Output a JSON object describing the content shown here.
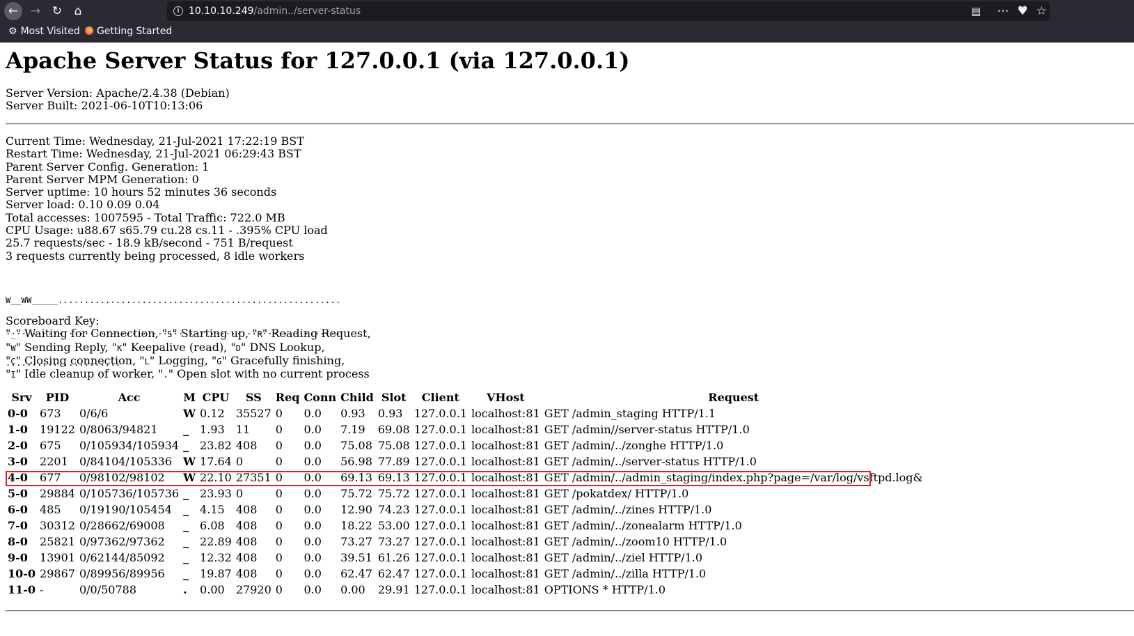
{
  "browser": {
    "url_host": "10.10.10.249",
    "url_path": "/admin../server-status",
    "bookmarks": [
      {
        "label": "Most Visited",
        "icon": "gear-icon"
      },
      {
        "label": "Getting Started",
        "icon": "firefox-icon"
      }
    ]
  },
  "page": {
    "title": "Apache Server Status for 127.0.0.1 (via 127.0.0.1)",
    "server_version": "Server Version: Apache/2.4.38 (Debian)",
    "server_built": "Server Built: 2021-06-10T10:13:06",
    "info_lines": [
      "Current Time: Wednesday, 21-Jul-2021 17:22:19 BST",
      "Restart Time: Wednesday, 21-Jul-2021 06:29:43 BST",
      "Parent Server Config. Generation: 1",
      "Parent Server MPM Generation: 0",
      "Server uptime: 10 hours 52 minutes 36 seconds",
      "Server load: 0.10 0.09 0.04",
      "Total accesses: 1007595 - Total Traffic: 722.0 MB",
      "CPU Usage: u88.67 s65.79 cu.28 cs.11 - .395% CPU load",
      "25.7 requests/sec - 18.9 kB/second - 751 B/request",
      "3 requests currently being processed, 8 idle workers"
    ],
    "scoreboard": [
      "W__WW_____......................................................",
      "................................................................",
      "......................"
    ],
    "key_title": "Scoreboard Key:",
    "key_lines": [
      [
        "\"",
        "_",
        "\" Waiting for Connection, \"",
        "S",
        "\" Starting up, \"",
        "R",
        "\" Reading Request,"
      ],
      [
        "\"",
        "W",
        "\" Sending Reply, \"",
        "K",
        "\" Keepalive (read), \"",
        "D",
        "\" DNS Lookup,"
      ],
      [
        "\"",
        "C",
        "\" Closing connection, \"",
        "L",
        "\" Logging, \"",
        "G",
        "\" Gracefully finishing,"
      ],
      [
        "\"",
        "I",
        "\" Idle cleanup of worker, \"",
        ".",
        "\" Open slot with no current process"
      ]
    ],
    "table_headers": [
      "Srv",
      "PID",
      "Acc",
      "M",
      "CPU",
      "SS",
      "Req",
      "Conn",
      "Child",
      "Slot",
      "Client",
      "VHost",
      "Request"
    ],
    "rows": [
      [
        "0-0",
        "673",
        "0/6/6",
        "W",
        "0.12",
        "35527",
        "0",
        "0.0",
        "0.93",
        "0.93",
        "127.0.0.1",
        "localhost:81",
        "GET /admin_staging HTTP/1.1"
      ],
      [
        "1-0",
        "19122",
        "0/8063/94821",
        "_",
        "1.93",
        "11",
        "0",
        "0.0",
        "7.19",
        "69.08",
        "127.0.0.1",
        "localhost:81",
        "GET /admin//server-status HTTP/1.0"
      ],
      [
        "2-0",
        "675",
        "0/105934/105934",
        "_",
        "23.82",
        "408",
        "0",
        "0.0",
        "75.08",
        "75.08",
        "127.0.0.1",
        "localhost:81",
        "GET /admin/../zonghe HTTP/1.0"
      ],
      [
        "3-0",
        "2201",
        "0/84104/105336",
        "W",
        "17.64",
        "0",
        "0",
        "0.0",
        "56.98",
        "77.89",
        "127.0.0.1",
        "localhost:81",
        "GET /admin/../server-status HTTP/1.0"
      ],
      [
        "4-0",
        "677",
        "0/98102/98102",
        "W",
        "22.10",
        "27351",
        "0",
        "0.0",
        "69.13",
        "69.13",
        "127.0.0.1",
        "localhost:81",
        "GET /admin/../admin_staging/index.php?page=/var/log/vsftpd.log&"
      ],
      [
        "5-0",
        "29884",
        "0/105736/105736",
        "_",
        "23.93",
        "0",
        "0",
        "0.0",
        "75.72",
        "75.72",
        "127.0.0.1",
        "localhost:81",
        "GET /pokatdex/ HTTP/1.0"
      ],
      [
        "6-0",
        "485",
        "0/19190/105454",
        "_",
        "4.15",
        "408",
        "0",
        "0.0",
        "12.90",
        "74.23",
        "127.0.0.1",
        "localhost:81",
        "GET /admin/../zines HTTP/1.0"
      ],
      [
        "7-0",
        "30312",
        "0/28662/69008",
        "_",
        "6.08",
        "408",
        "0",
        "0.0",
        "18.22",
        "53.00",
        "127.0.0.1",
        "localhost:81",
        "GET /admin/../zonealarm HTTP/1.0"
      ],
      [
        "8-0",
        "25821",
        "0/97362/97362",
        "_",
        "22.89",
        "408",
        "0",
        "0.0",
        "73.27",
        "73.27",
        "127.0.0.1",
        "localhost:81",
        "GET /admin/../zoom10 HTTP/1.0"
      ],
      [
        "9-0",
        "13901",
        "0/62144/85092",
        "_",
        "12.32",
        "408",
        "0",
        "0.0",
        "39.51",
        "61.26",
        "127.0.0.1",
        "localhost:81",
        "GET /admin/../ziel HTTP/1.0"
      ],
      [
        "10-0",
        "29867",
        "0/89956/89956",
        "_",
        "19.87",
        "408",
        "0",
        "0.0",
        "62.47",
        "62.47",
        "127.0.0.1",
        "localhost:81",
        "GET /admin/../zilla HTTP/1.0"
      ],
      [
        "11-0",
        "-",
        "0/0/50788",
        ".",
        "0.00",
        "27920",
        "0",
        "0.0",
        "0.00",
        "29.91",
        "127.0.0.1",
        "localhost:81",
        "OPTIONS * HTTP/1.0"
      ]
    ],
    "highlight_color": "#e02020"
  }
}
